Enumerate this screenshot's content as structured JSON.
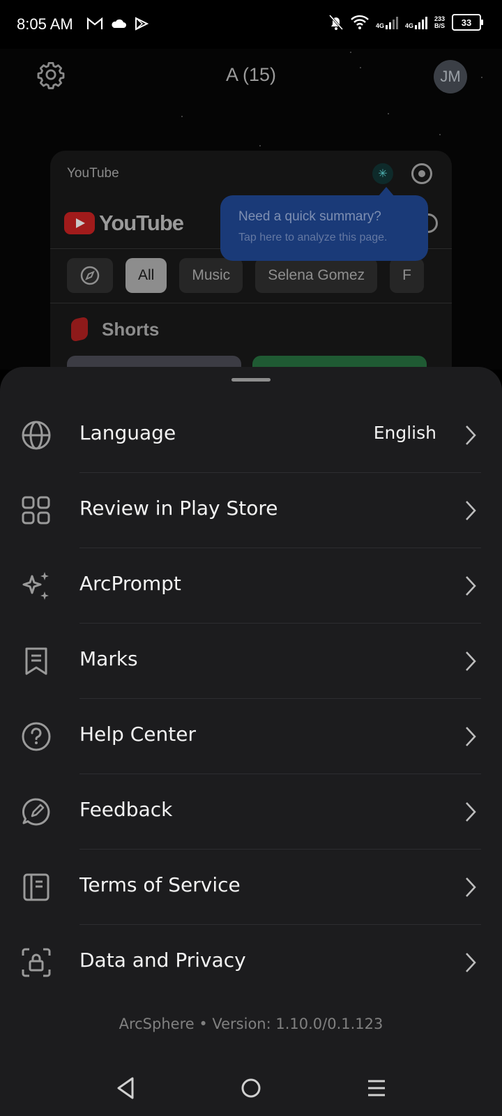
{
  "status_bar": {
    "time": "8:05 AM",
    "network_4g_1": "4G",
    "network_4g_2": "4G",
    "speed_value": "233",
    "speed_unit": "B/S",
    "battery": "33"
  },
  "header": {
    "tabs_title": "A (15)",
    "avatar_initials": "JM"
  },
  "tab_preview": {
    "title": "YouTube",
    "logo_text": "YouTube",
    "chips": [
      "All",
      "Music",
      "Selena Gomez",
      "F"
    ],
    "shorts_label": "Shorts"
  },
  "tooltip": {
    "title": "Need a quick summary?",
    "subtitle": "Tap here to analyze this page."
  },
  "menu": {
    "items": [
      {
        "label": "Language",
        "value": "English",
        "icon": "globe-icon"
      },
      {
        "label": "Review in Play Store",
        "icon": "grid-icon"
      },
      {
        "label": "ArcPrompt",
        "icon": "sparkles-icon"
      },
      {
        "label": "Marks",
        "icon": "bookmark-icon"
      },
      {
        "label": "Help Center",
        "icon": "help-circle-icon"
      },
      {
        "label": "Feedback",
        "icon": "feedback-icon"
      },
      {
        "label": "Terms of Service",
        "icon": "document-icon"
      },
      {
        "label": "Data and Privacy",
        "icon": "lock-icon"
      }
    ]
  },
  "footer": {
    "version": "ArcSphere • Version: 1.10.0/0.1.123"
  },
  "colors": {
    "sheet_bg": "#1c1c1e",
    "tooltip_bg": "#1a3a78",
    "text_primary": "#f2f2f2",
    "text_muted": "#808080"
  }
}
